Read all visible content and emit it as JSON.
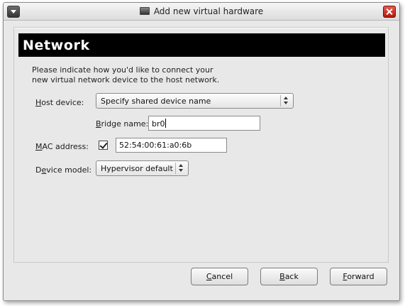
{
  "window": {
    "title": "Add new virtual hardware"
  },
  "banner": {
    "title": "Network"
  },
  "intro": {
    "line1": "Please indicate how you'd like to connect your",
    "line2": "new virtual network device to the host network."
  },
  "host_device": {
    "label_mnemonic": "H",
    "label_rest": "ost device:",
    "value": "Specify shared device name"
  },
  "bridge": {
    "label_mnemonic": "B",
    "label_rest": "ridge name:",
    "value": "br0"
  },
  "mac": {
    "label_mnemonic": "M",
    "label_rest": "AC address:",
    "checked": true,
    "value": "52:54:00:61:a0:6b"
  },
  "device_model": {
    "label_prefix": "D",
    "label_mnemonic": "e",
    "label_rest": "vice model:",
    "value": "Hypervisor default"
  },
  "buttons": {
    "cancel": {
      "mnemonic": "C",
      "rest": "ancel"
    },
    "back": {
      "mnemonic": "B",
      "rest": "ack"
    },
    "forward": {
      "mnemonic": "F",
      "rest": "orward"
    }
  },
  "icons": {
    "window_menu": "chevron-down-icon",
    "title": "monitor-icon",
    "close": "close-icon"
  },
  "colors": {
    "banner_bg": "#000000",
    "banner_text": "#ffffff",
    "close_button": "#c8281c",
    "window_bg": "#e8e8e8"
  }
}
